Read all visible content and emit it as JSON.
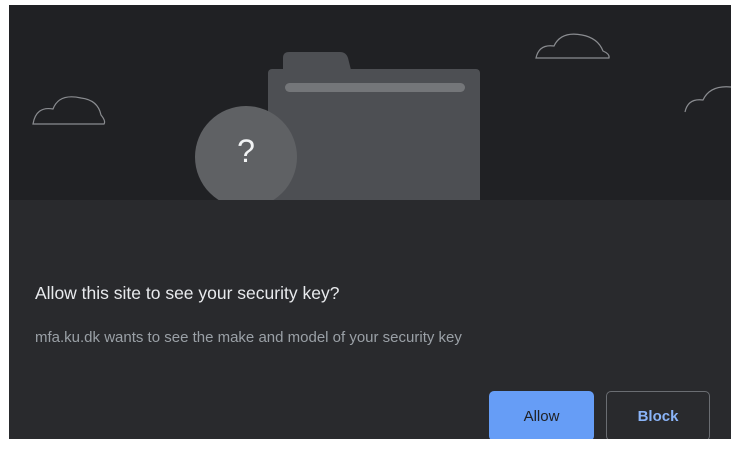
{
  "dialog": {
    "illustration": {
      "question_mark": "?",
      "icons": [
        "cloud-icon",
        "folder-icon",
        "question-badge-icon"
      ]
    },
    "title": "Allow this site to see your security key?",
    "description": "mfa.ku.dk wants to see the make and model of your security key",
    "buttons": {
      "allow_label": "Allow",
      "block_label": "Block"
    }
  },
  "colors": {
    "dialog_background": "#292a2d",
    "illustration_background": "#202124",
    "title_text": "#e8eaed",
    "description_text": "#9aa0a6",
    "primary_button": "#669df6",
    "secondary_button_text": "#8ab4f8"
  }
}
